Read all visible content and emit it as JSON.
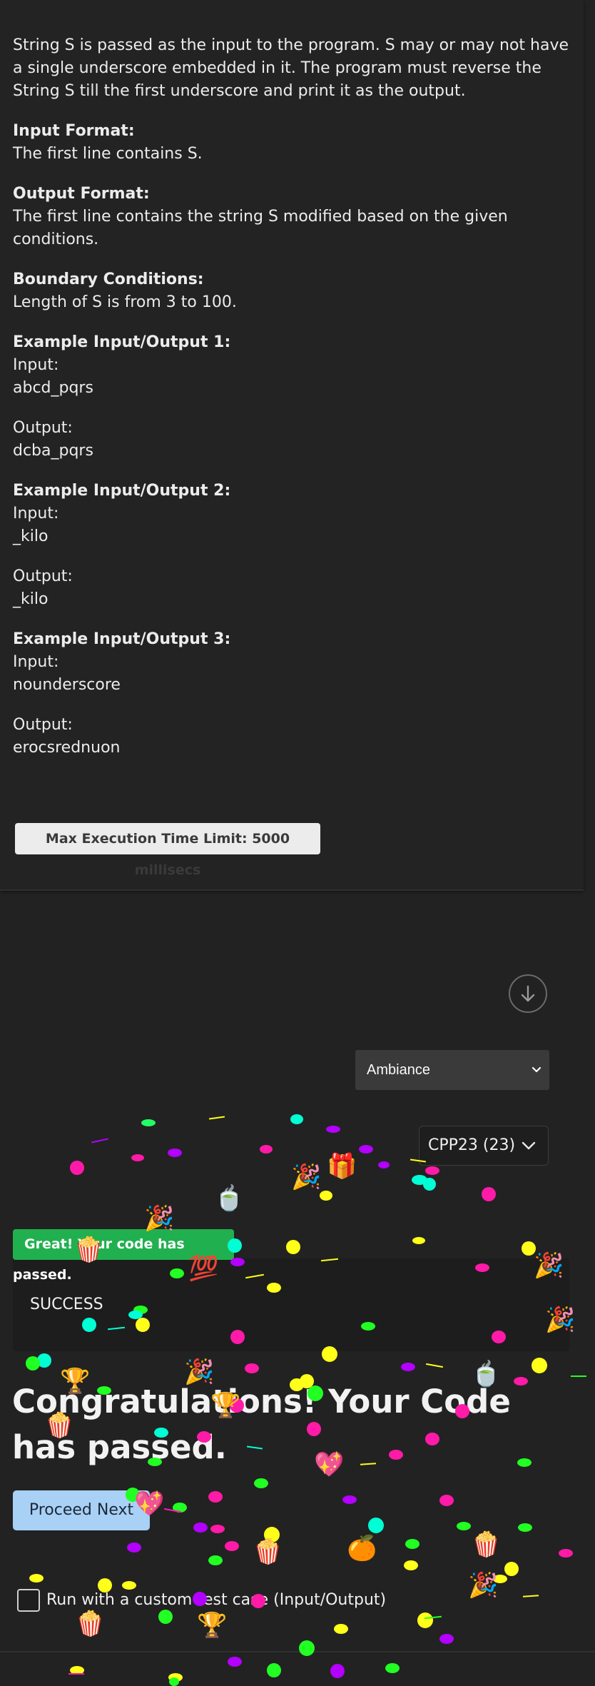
{
  "problem": {
    "description": "String S is passed as the input to the program. S may or may not have a single underscore embedded in it. The program must reverse the String S till the first underscore and print it as the output.",
    "input_format_heading": "Input Format:",
    "input_format": "The first line contains S.",
    "output_format_heading": "Output Format:",
    "output_format": "The first line contains the string S modified based on the given conditions.",
    "boundary_heading": "Boundary Conditions:",
    "boundary": "Length of S is from 3 to 100.",
    "examples": [
      {
        "heading": "Example Input/Output 1:",
        "input_label": "Input:",
        "input": "abcd_pqrs",
        "output_label": "Output:",
        "output": "dcba_pqrs"
      },
      {
        "heading": "Example Input/Output 2:",
        "input_label": "Input:",
        "input": "_kilo",
        "output_label": "Output:",
        "output": "_kilo"
      },
      {
        "heading": "Example Input/Output 3:",
        "input_label": "Input:",
        "input": "nounderscore",
        "output_label": "Output:",
        "output": "erocsrednuon"
      }
    ],
    "time_limit": "Max Execution Time Limit: 5000 millisecs"
  },
  "controls": {
    "scroll_icon": "arrow-down-circle-icon",
    "ambiance_select": "Ambiance",
    "language_select": "CPP23 (23)"
  },
  "result": {
    "badge": "Great! Your code has passed.",
    "status": "SUCCESS",
    "congrats": "Congratulations! Your Code has passed.",
    "proceed_button": "Proceed Next",
    "custom_test_label": "Run with a custom test case (Input/Output)"
  },
  "colors": {
    "background": "#222222",
    "success_green": "#21b04f",
    "proceed_blue": "#a9d0f5",
    "confetti": [
      "#ff1aa8",
      "#ffff1a",
      "#00ffd5",
      "#22ff22",
      "#b300ff",
      "#ff2266"
    ]
  }
}
